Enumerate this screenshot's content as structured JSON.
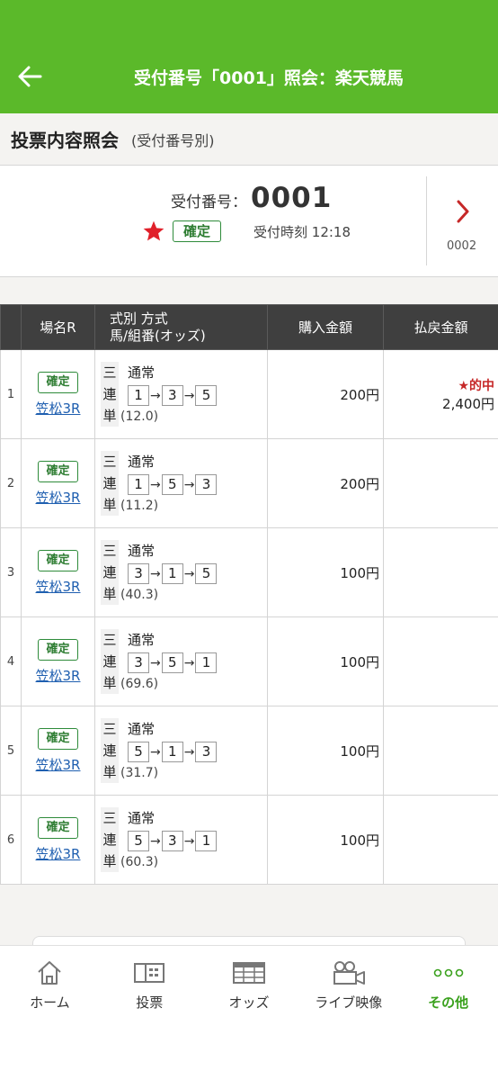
{
  "header": {
    "title": "受付番号「0001」照会：楽天競馬"
  },
  "section": {
    "title": "投票内容照会",
    "subtitle": "(受付番号別)"
  },
  "receipt": {
    "number_label": "受付番号：",
    "number": "0001",
    "status": "確定",
    "time": "受付時刻 12:18",
    "next_number": "0002"
  },
  "table": {
    "headers": {
      "venue": "場名R",
      "type_line1": "式別 方式",
      "type_line2": "馬/組番(オッズ)",
      "amount": "購入金額",
      "payout": "払戻金額"
    },
    "rows": [
      {
        "idx": "1",
        "status": "確定",
        "venue": "笠松3R",
        "kind": [
          "三",
          "連",
          "単"
        ],
        "method": "通常",
        "horses": [
          "1",
          "3",
          "5"
        ],
        "odds": "(12.0)",
        "amount": "200円",
        "hit": "★的中",
        "payout": "2,400円"
      },
      {
        "idx": "2",
        "status": "確定",
        "venue": "笠松3R",
        "kind": [
          "三",
          "連",
          "単"
        ],
        "method": "通常",
        "horses": [
          "1",
          "5",
          "3"
        ],
        "odds": "(11.2)",
        "amount": "200円",
        "hit": "",
        "payout": ""
      },
      {
        "idx": "3",
        "status": "確定",
        "venue": "笠松3R",
        "kind": [
          "三",
          "連",
          "単"
        ],
        "method": "通常",
        "horses": [
          "3",
          "1",
          "5"
        ],
        "odds": "(40.3)",
        "amount": "100円",
        "hit": "",
        "payout": ""
      },
      {
        "idx": "4",
        "status": "確定",
        "venue": "笠松3R",
        "kind": [
          "三",
          "連",
          "単"
        ],
        "method": "通常",
        "horses": [
          "3",
          "5",
          "1"
        ],
        "odds": "(69.6)",
        "amount": "100円",
        "hit": "",
        "payout": ""
      },
      {
        "idx": "5",
        "status": "確定",
        "venue": "笠松3R",
        "kind": [
          "三",
          "連",
          "単"
        ],
        "method": "通常",
        "horses": [
          "5",
          "1",
          "3"
        ],
        "odds": "(31.7)",
        "amount": "100円",
        "hit": "",
        "payout": ""
      },
      {
        "idx": "6",
        "status": "確定",
        "venue": "笠松3R",
        "kind": [
          "三",
          "連",
          "単"
        ],
        "method": "通常",
        "horses": [
          "5",
          "3",
          "1"
        ],
        "odds": "(60.3)",
        "amount": "100円",
        "hit": "",
        "payout": ""
      }
    ]
  },
  "nav": {
    "home": "ホーム",
    "vote": "投票",
    "odds": "オッズ",
    "live": "ライブ映像",
    "other": "その他"
  },
  "colors": {
    "brand": "#5bb92a",
    "active_nav": "#3aa11d",
    "hit": "#c62828",
    "confirm_badge": "#2e7d32"
  }
}
